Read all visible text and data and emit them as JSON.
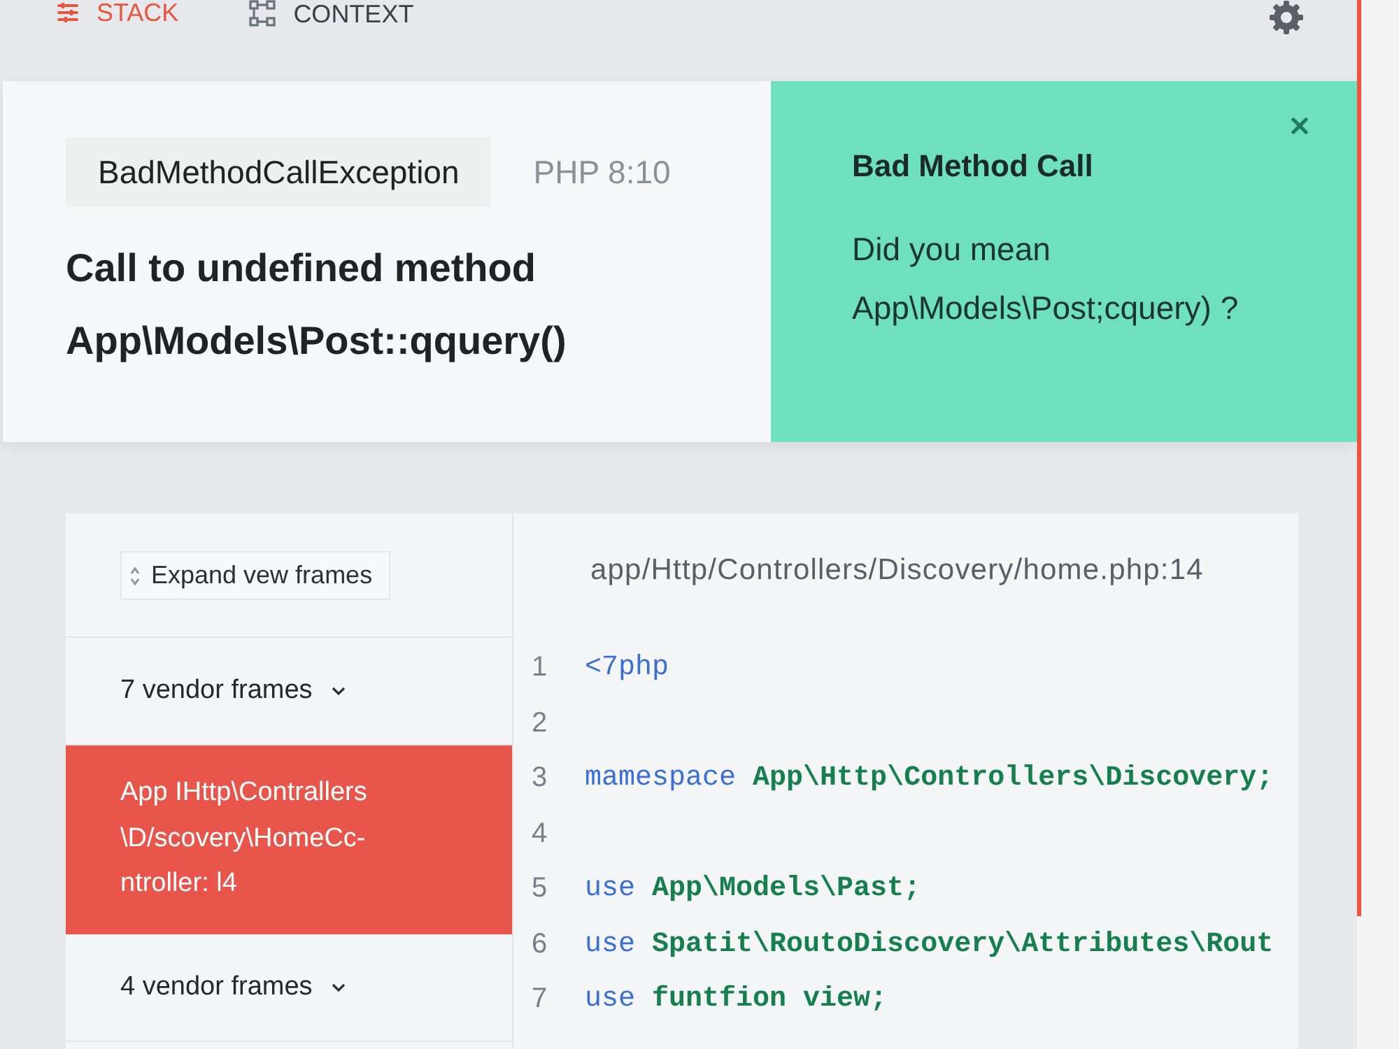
{
  "nav": {
    "tabs": [
      {
        "label": "STACK",
        "selected": true
      },
      {
        "label": "CONTEXT",
        "selected": false
      }
    ]
  },
  "error": {
    "exception": "BadMethodCallException",
    "php_version": "PHP 8:10",
    "message": "Call to undefined method App\\Models\\Post::qquery()"
  },
  "solution": {
    "title": "Bad Method Call",
    "text": "Did you mean App\\Models\\Post;cquery) ?"
  },
  "stack": {
    "expand_button": "Expand vew frames",
    "frames": [
      {
        "kind": "vendor",
        "label": "7 vendor frames",
        "selected": false
      },
      {
        "kind": "app",
        "label": "App IHttp\\Contrallers \\D/scovery\\HomeCc- ntroller: l4",
        "selected": true
      },
      {
        "kind": "vendor",
        "label": "4 vendor frames",
        "selected": false
      }
    ]
  },
  "code": {
    "file": "app/Http/Controllers/Discovery/home.php:14",
    "lines": [
      {
        "number": "1",
        "tokens": [
          {
            "kind": "keyword",
            "text": "<7php"
          }
        ]
      },
      {
        "number": "2"
      },
      {
        "number": "3",
        "tokens": [
          {
            "kind": "keyword",
            "text": "mamespace"
          },
          {
            "kind": "name",
            "text": "App\\Http\\Controllers\\Discovery;"
          }
        ]
      },
      {
        "number": "4"
      },
      {
        "number": "5",
        "tokens": [
          {
            "kind": "keyword",
            "text": "use"
          },
          {
            "kind": "name",
            "text": "App\\Models\\Past;"
          }
        ]
      },
      {
        "number": "6",
        "tokens": [
          {
            "kind": "keyword",
            "text": "use"
          },
          {
            "kind": "name",
            "text": "Spatit\\RoutoDiscovery\\Attributes\\Rout"
          }
        ]
      },
      {
        "number": "7",
        "tokens": [
          {
            "kind": "keyword",
            "text": "use"
          },
          {
            "kind": "name",
            "text": "funtfion view;"
          }
        ]
      }
    ]
  }
}
